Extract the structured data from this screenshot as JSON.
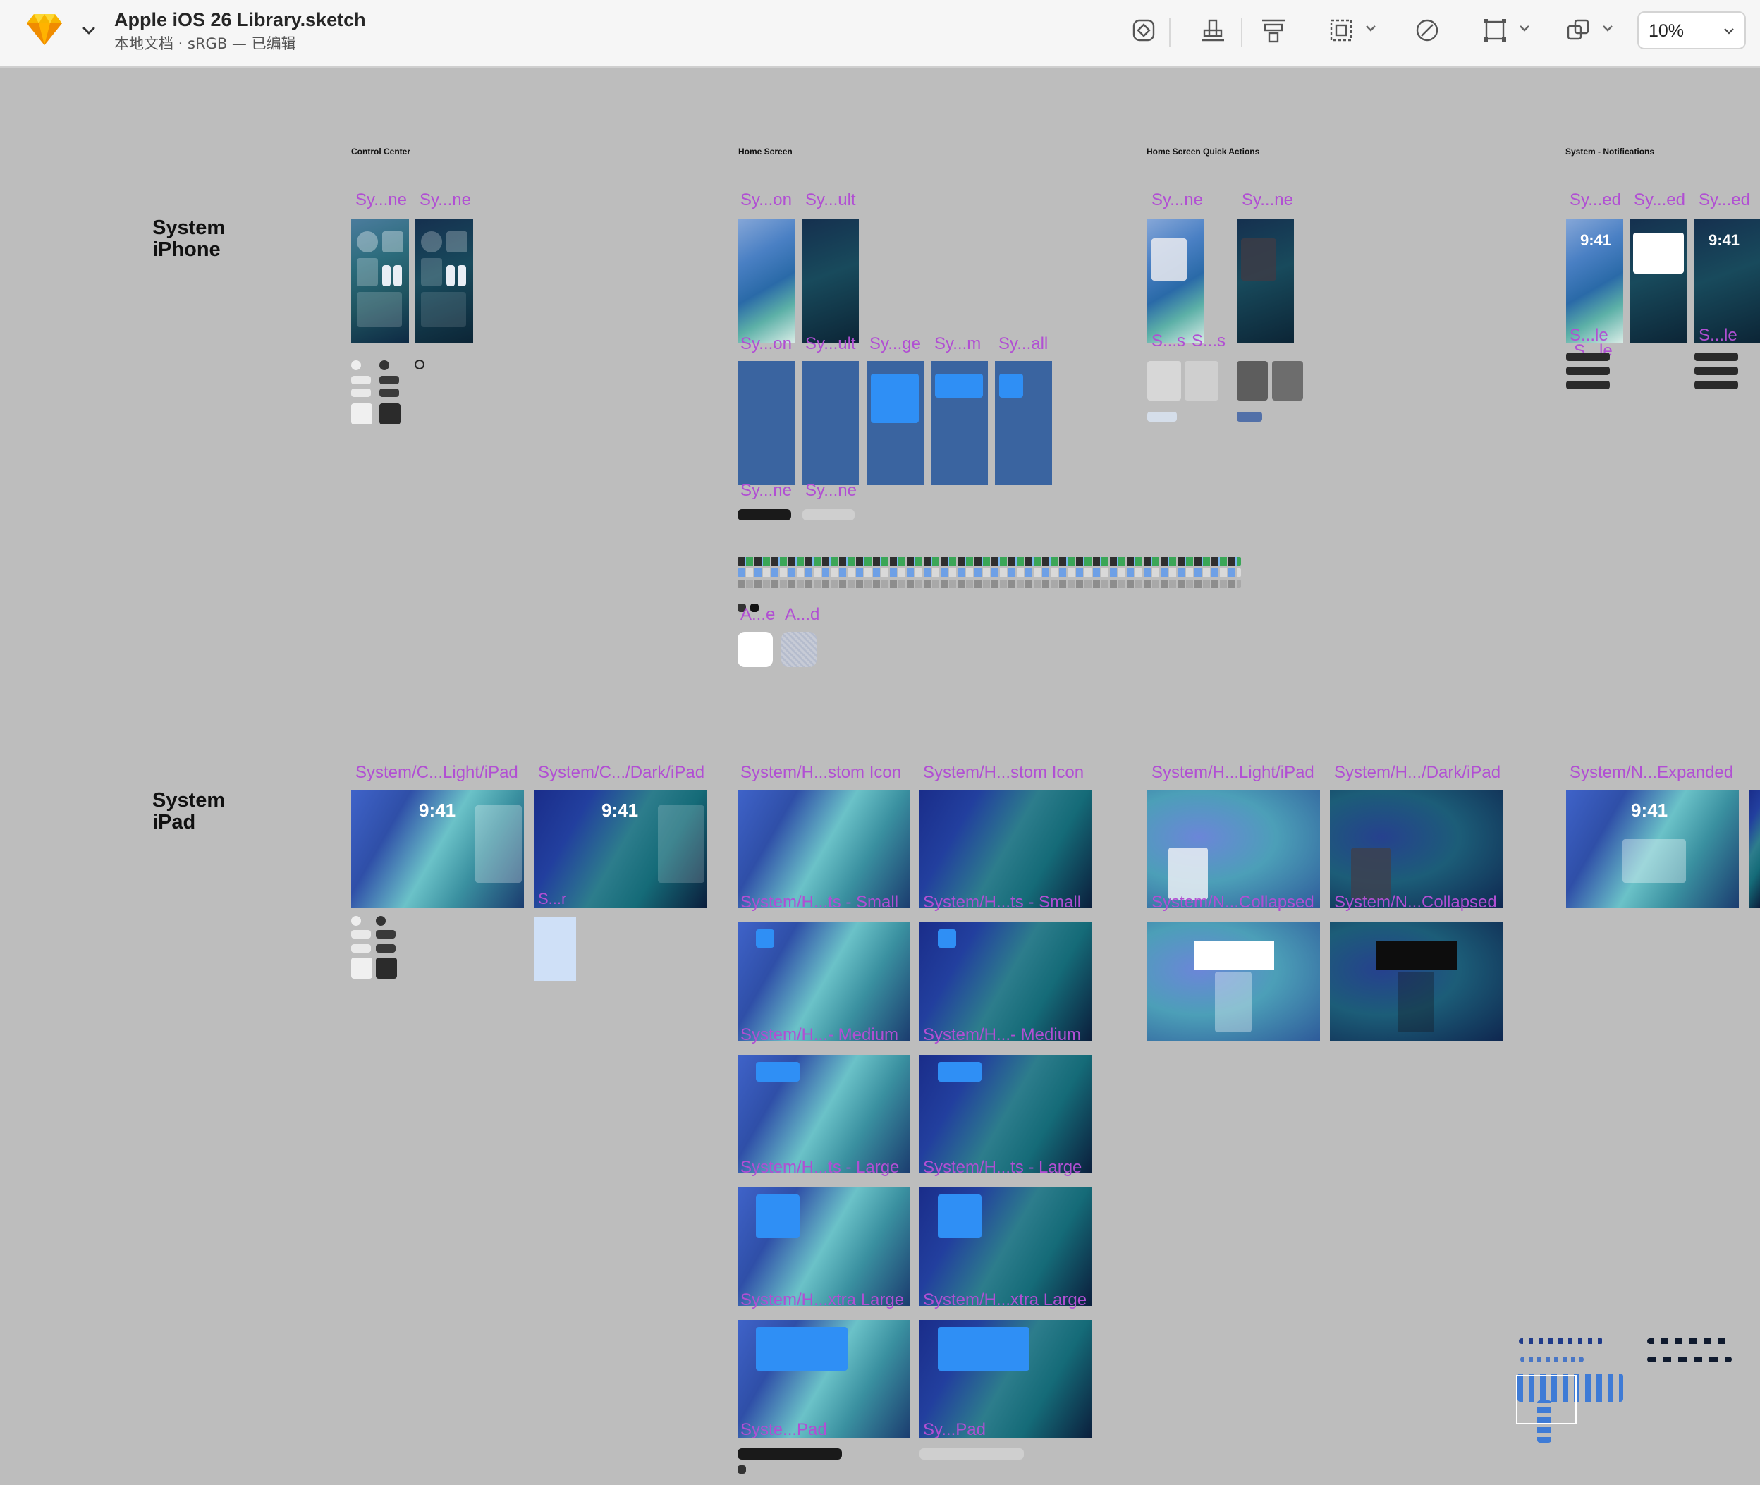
{
  "toolbar": {
    "app_logo_icon": "sketch-diamond-icon",
    "doc_title": "Apple iOS 26 Library.sketch",
    "doc_subtitle": "本地文档 · sRGB — 已编辑",
    "zoom_value": "10%"
  },
  "canvas": {
    "sections": {
      "control_center": "Control Center",
      "home_screen": "Home Screen",
      "quick_actions": "Home Screen Quick Actions",
      "notifications": "System - Notifications"
    },
    "rows": {
      "iphone": [
        "System",
        "iPhone"
      ],
      "ipad": [
        "System",
        "iPad"
      ]
    },
    "iphone_labels": {
      "cc1": "Sy...ne",
      "cc2": "Sy...ne",
      "hs1": "Sy...on",
      "hs2": "Sy...ult",
      "hs3": "Sy...on",
      "hs4": "Sy...ult",
      "hs5": "Sy...ge",
      "hs6": "Sy...m",
      "hs7": "Sy...all",
      "dock1": "Sy...ne",
      "dock2": "Sy...ne",
      "qa1": "Sy...ne",
      "qa2": "Sy...ne",
      "qa3": "S...s",
      "qa4": "S...s",
      "n1": "Sy...ed",
      "n2": "Sy...ed",
      "n3": "Sy...ed",
      "n4": "S...le",
      "n5": "S...le",
      "n6": "S...le",
      "asset1": "A...e",
      "asset2": "A...d"
    },
    "ipad_labels": {
      "cc_light": "System/C...Light/iPad",
      "cc_dark": "System/C.../Dark/iPad",
      "h1": "System/H...stom Icon",
      "h2": "System/H...stom Icon",
      "qa_light": "System/H...Light/iPad",
      "qa_dark": "System/H.../Dark/iPad",
      "n_exp": "System/N...Expanded",
      "small1": "System/H...ts - Small",
      "small2": "System/H...ts - Small",
      "coll1": "System/N...Collapsed",
      "coll2": "System/N...Collapsed",
      "med1": "System/H...- Medium",
      "med2": "System/H...- Medium",
      "lg1": "System/H...ts - Large",
      "lg2": "System/H...ts - Large",
      "xl1": "System/H...xtra Large",
      "xl2": "System/H...xtra Large",
      "s_r": "S...r",
      "bottom1": "Syste...Pad",
      "bottom2": "Sy...Pad"
    },
    "clock": "9:41"
  }
}
